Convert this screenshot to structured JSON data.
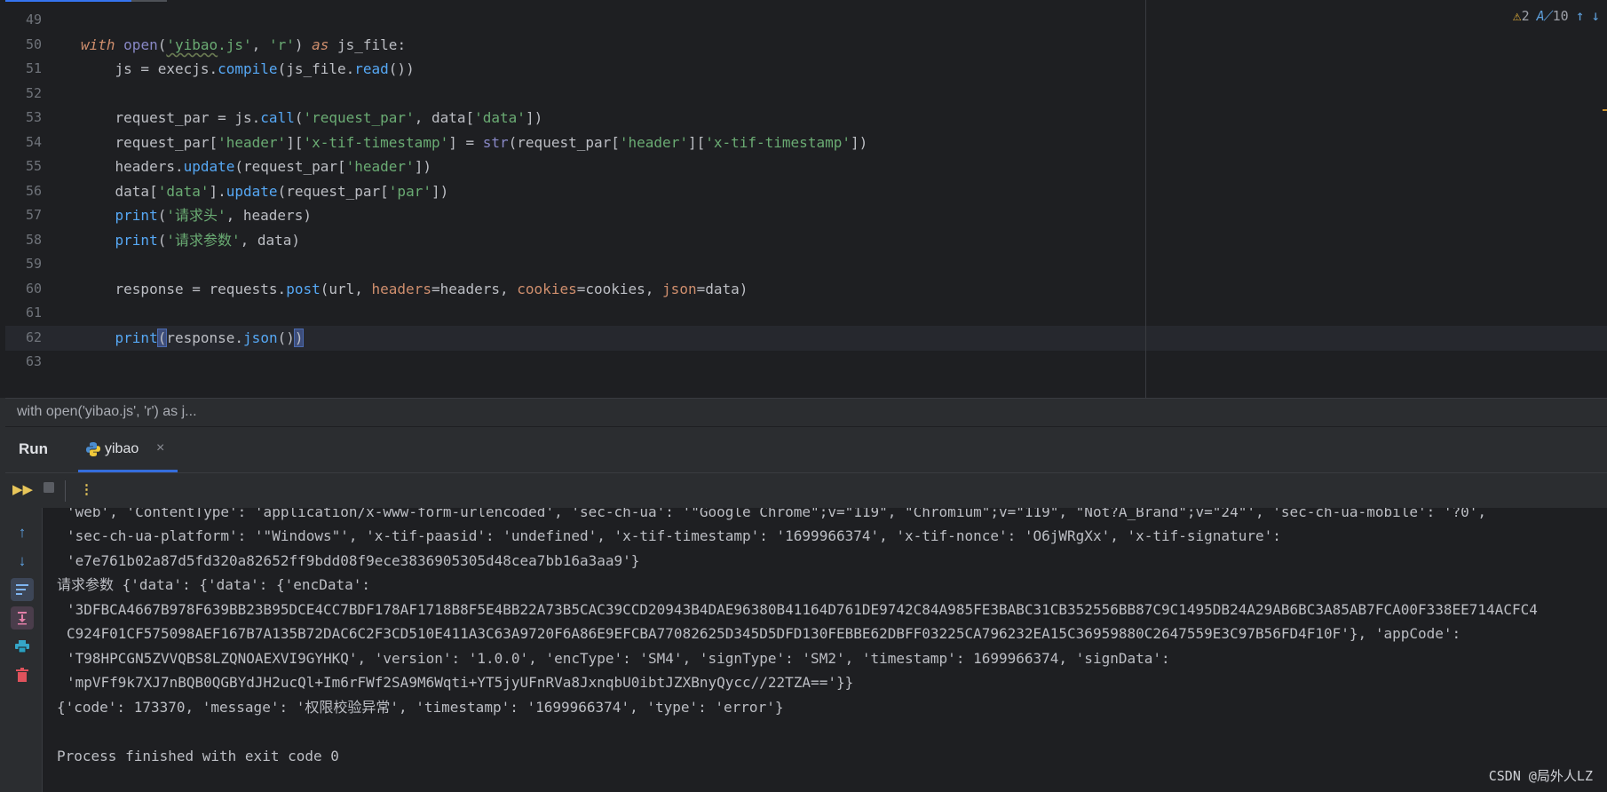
{
  "editor": {
    "line_numbers": [
      "49",
      "50",
      "51",
      "52",
      "53",
      "54",
      "55",
      "56",
      "57",
      "58",
      "59",
      "60",
      "61",
      "62",
      "63"
    ],
    "inspections": {
      "warnings": "2",
      "typos": "10"
    }
  },
  "code": {
    "l50": {
      "with": "with",
      "open": "open",
      "p1": "(",
      "s_file": "'yibao",
      "s_ext": ".js'",
      "c1": ", ",
      "s_mode": "'r'",
      "p2": ") ",
      "as": "as",
      "rest": " js_file:"
    },
    "l51": {
      "a": "    js = execjs.",
      "compile": "compile",
      "b": "(js_file.",
      "read": "read",
      "c": "())"
    },
    "l53": {
      "a": "    request_par = js.",
      "call": "call",
      "b": "(",
      "s1": "'request_par'",
      "c": ", data[",
      "s2": "'data'",
      "d": "])"
    },
    "l54": {
      "a": "    request_par[",
      "s1": "'header'",
      "b": "][",
      "s2": "'x-tif-timestamp'",
      "c": "] = ",
      "str": "str",
      "d": "(request_par[",
      "s3": "'header'",
      "e": "][",
      "s4": "'x-tif-timestamp'",
      "f": "])"
    },
    "l55": {
      "a": "    headers.",
      "update": "update",
      "b": "(request_par[",
      "s1": "'header'",
      "c": "])"
    },
    "l56": {
      "a": "    data[",
      "s1": "'data'",
      "b": "].",
      "update": "update",
      "c": "(request_par[",
      "s2": "'par'",
      "d": "])"
    },
    "l57": {
      "a": "    ",
      "print": "print",
      "b": "(",
      "s1": "'请求头'",
      "c": ", headers)"
    },
    "l58": {
      "a": "    ",
      "print": "print",
      "b": "(",
      "s1": "'请求参数'",
      "c": ", data)"
    },
    "l60": {
      "a": "    response = requests.",
      "post": "post",
      "b": "(url, ",
      "k1": "headers",
      "c": "=headers, ",
      "k2": "cookies",
      "d": "=cookies, ",
      "k3": "json",
      "e": "=data)"
    },
    "l62": {
      "a": "    ",
      "print": "print",
      "p_open": "(",
      "b": "response.",
      "json": "json",
      "c": "()",
      "p_close": ")"
    }
  },
  "breadcrumb": "with open('yibao.js', 'r') as j...",
  "run_panel": {
    "title": "Run",
    "tab_label": "yibao",
    "close_glyph": "×"
  },
  "console": {
    "lines": [
      "'web', 'ContentType': 'application/x-www-form-urlencoded', 'sec-ch-ua': '\"Google Chrome\";v=\"119\", \"Chromium\";v=\"119\", \"Not?A_Brand\";v=\"24\"', 'sec-ch-ua-mobile': '?0',",
      "'sec-ch-ua-platform': '\"Windows\"', 'x-tif-paasid': 'undefined', 'x-tif-timestamp': '1699966374', 'x-tif-nonce': 'O6jWRgXx', 'x-tif-signature':",
      "'e7e761b02a87d5fd320a82652ff9bdd08f9ece3836905305d48cea7bb16a3aa9'}",
      "请求参数 {'data': {'data': {'encData':",
      "'3DFBCA4667B978F639BB23B95DCE4CC7BDF178AF1718B8F5E4BB22A73B5CAC39CCD20943B4DAE96380B41164D761DE9742C84A985FE3BABC31CB352556BB87C9C1495DB24A29AB6BC3A85AB7FCA00F338EE714ACFC4",
      "C924F01CF575098AEF167B7A135B72DAC6C2F3CD510E411A3C63A9720F6A86E9EFCBA77082625D345D5DFD130FEBBE62DBFF03225CA796232EA15C36959880C2647559E3C97B56FD4F10F'}, 'appCode':",
      "'T98HPCGN5ZVVQBS8LZQNOAEXVI9GYHKQ', 'version': '1.0.0', 'encType': 'SM4', 'signType': 'SM2', 'timestamp': 1699966374, 'signData':",
      "'mpVFf9k7XJ7nBQB0QGBYdJH2ucQl+Im6rFWf2SA9M6Wqti+YT5jyUFnRVa8JxnqbU0ibtJZXBnyQycc//22TZA=='}}",
      "{'code': 173370, 'message': '权限校验异常', 'timestamp': '1699966374', 'type': 'error'}",
      "",
      "Process finished with exit code 0"
    ],
    "watermark": "CSDN @局外人LZ"
  },
  "colors": {
    "background": "#1e1f22",
    "panel": "#2b2d30",
    "keyword": "#cf8e6d",
    "string": "#6aab73",
    "function": "#56a8f5",
    "builtin": "#8888c6",
    "param": "#b89a71",
    "accent": "#3574f0"
  },
  "icons": {
    "warnings": "warning-triangle-icon",
    "typos": "spellcheck-icon",
    "prev": "arrow-up-icon",
    "next": "arrow-down-icon",
    "rerun": "rerun-icon",
    "stop": "stop-icon",
    "more": "more-vertical-icon",
    "scroll_up": "arrow-up-icon",
    "scroll_down": "arrow-down-icon",
    "soft_wrap": "soft-wrap-icon",
    "scroll_end": "scroll-to-end-icon",
    "print": "print-icon",
    "clear": "trash-icon",
    "python": "python-icon"
  }
}
